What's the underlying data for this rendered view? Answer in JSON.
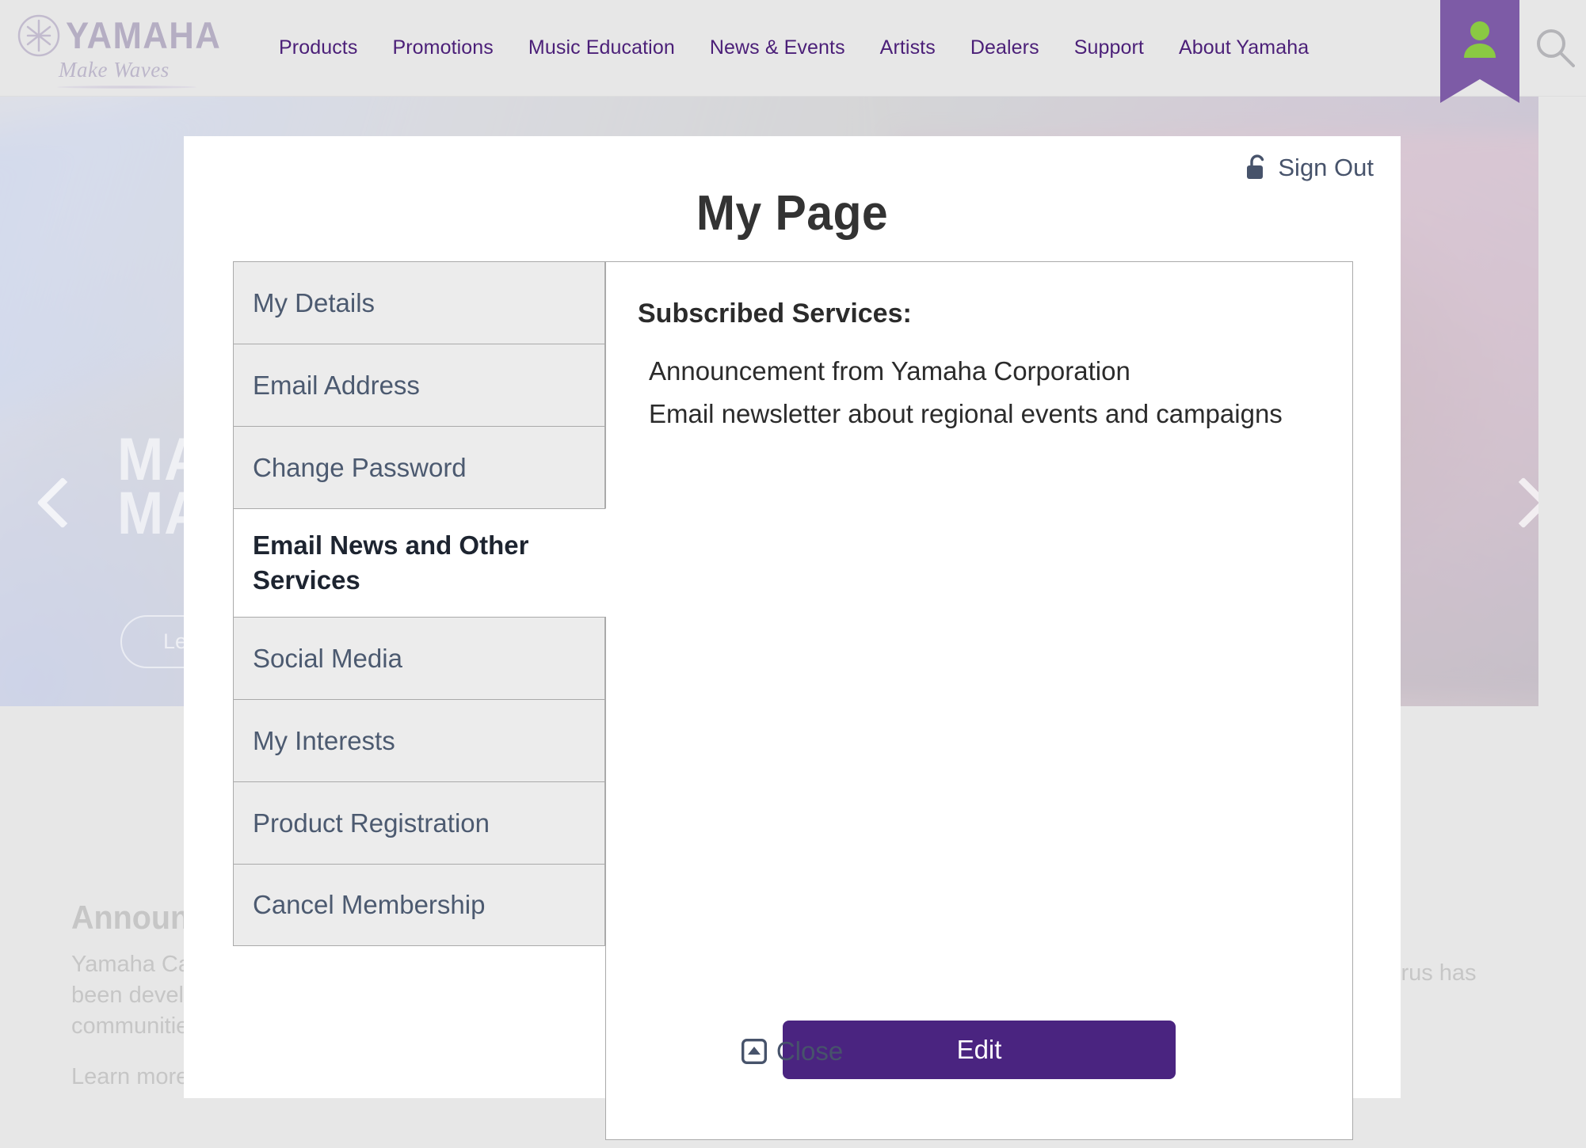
{
  "header": {
    "logo": {
      "wordmark": "YAMAHA",
      "tagline": "Make Waves",
      "mark_icon": "yamaha-tuning-fork-icon"
    },
    "nav": [
      {
        "label": "Products"
      },
      {
        "label": "Promotions"
      },
      {
        "label": "Music Education"
      },
      {
        "label": "News & Events"
      },
      {
        "label": "Artists"
      },
      {
        "label": "Dealers"
      },
      {
        "label": "Support"
      },
      {
        "label": "About Yamaha"
      }
    ],
    "account_icon": "person-icon",
    "search_icon": "search-icon",
    "accent_purple": "#4b1f78",
    "tab_purple": "#7d5ba6",
    "account_green": "#8ac943"
  },
  "hero": {
    "headline": "MA\nMA",
    "cta_label": "Lea",
    "prev_icon": "chevron-left-icon",
    "next_icon": "chevron-right-icon"
  },
  "announcement": {
    "title": "Announc",
    "body_line1": "Yamaha Ca",
    "body_line2": "been devel",
    "body_line3": "communitie",
    "body_right": "irus has",
    "link_label": "Learn more"
  },
  "modal": {
    "sign_out": {
      "label": "Sign Out",
      "icon": "unlock-icon"
    },
    "title": "My Page",
    "sidebar": [
      {
        "label": "My Details",
        "active": false
      },
      {
        "label": "Email Address",
        "active": false
      },
      {
        "label": "Change Password",
        "active": false
      },
      {
        "label": "Email News and Other Services",
        "active": true
      },
      {
        "label": "Social Media",
        "active": false
      },
      {
        "label": "My Interests",
        "active": false
      },
      {
        "label": "Product Registration",
        "active": false
      },
      {
        "label": "Cancel Membership",
        "active": false
      }
    ],
    "content": {
      "heading": "Subscribed Services:",
      "services": [
        "Announcement from Yamaha Corporation",
        "Email newsletter about regional events and campaigns"
      ],
      "edit_label": "Edit",
      "edit_color": "#4a2480"
    },
    "close": {
      "label": "Close",
      "icon": "collapse-up-icon"
    }
  }
}
